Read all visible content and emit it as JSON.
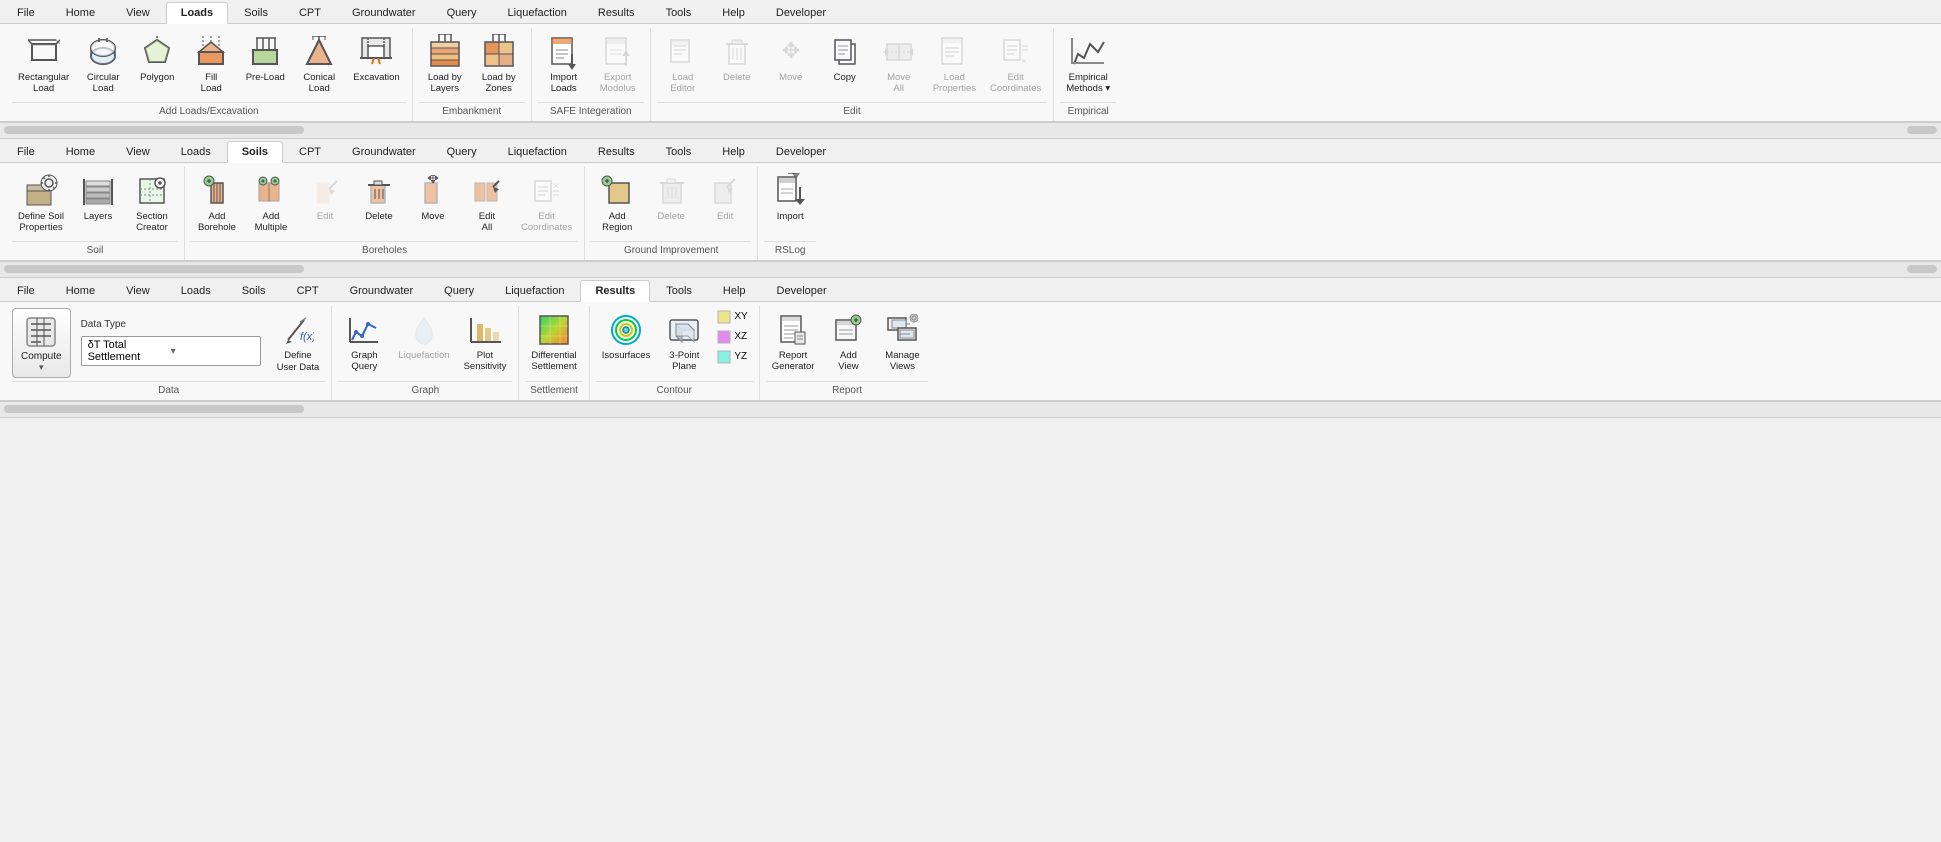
{
  "ribbons": [
    {
      "id": "loads-ribbon",
      "tabs": [
        "File",
        "Home",
        "View",
        "Loads",
        "Soils",
        "CPT",
        "Groundwater",
        "Query",
        "Liquefaction",
        "Results",
        "Tools",
        "Help",
        "Developer"
      ],
      "active_tab": "Loads",
      "groups": [
        {
          "id": "add-loads-excavation",
          "label": "Add Loads/Excavation",
          "buttons": [
            {
              "id": "rectangular-load",
              "label": "Rectangular\nLoad",
              "icon": "⬜",
              "disabled": false
            },
            {
              "id": "circular-load",
              "label": "Circular\nLoad",
              "icon": "⭕",
              "disabled": false
            },
            {
              "id": "polygon",
              "label": "Polygon",
              "icon": "⬠",
              "disabled": false
            },
            {
              "id": "fill-load",
              "label": "Fill\nLoad",
              "icon": "🟧",
              "disabled": false
            },
            {
              "id": "pre-load",
              "label": "Pre-Load",
              "icon": "🟩",
              "disabled": false
            },
            {
              "id": "conical-load",
              "label": "Conical\nLoad",
              "icon": "△",
              "disabled": false
            },
            {
              "id": "excavation",
              "label": "Excavation",
              "icon": "⛏",
              "disabled": false
            }
          ]
        },
        {
          "id": "embankment",
          "label": "Embankment",
          "buttons": [
            {
              "id": "load-by-layers",
              "label": "Load by\nLayers",
              "icon": "📊",
              "disabled": false
            },
            {
              "id": "load-by-zones",
              "label": "Load by\nZones",
              "icon": "📈",
              "disabled": false
            }
          ]
        },
        {
          "id": "safe-integration",
          "label": "SAFE Integeration",
          "buttons": [
            {
              "id": "import-loads",
              "label": "Import\nLoads",
              "icon": "📥",
              "disabled": false
            },
            {
              "id": "export-modolus",
              "label": "Export\nModolus",
              "icon": "📤",
              "disabled": true
            }
          ]
        },
        {
          "id": "edit-loads",
          "label": "Edit",
          "buttons": [
            {
              "id": "load-editor",
              "label": "Load\nEditor",
              "icon": "📝",
              "disabled": true
            },
            {
              "id": "delete-load",
              "label": "Delete",
              "icon": "🗑",
              "disabled": true
            },
            {
              "id": "move-load",
              "label": "Move",
              "icon": "✥",
              "disabled": true
            },
            {
              "id": "copy-load",
              "label": "Copy",
              "icon": "📋",
              "disabled": false
            },
            {
              "id": "move-all",
              "label": "Move\nAll",
              "icon": "⇄",
              "disabled": true
            },
            {
              "id": "load-properties",
              "label": "Load\nProperties",
              "icon": "📄",
              "disabled": true
            },
            {
              "id": "edit-coordinates",
              "label": "Edit\nCoordinates",
              "icon": "📌",
              "disabled": true
            }
          ]
        },
        {
          "id": "empirical",
          "label": "Empirical",
          "buttons": [
            {
              "id": "empirical-methods",
              "label": "Empirical\nMethods▾",
              "icon": "📉",
              "disabled": false
            }
          ]
        }
      ]
    },
    {
      "id": "soils-ribbon",
      "tabs": [
        "File",
        "Home",
        "View",
        "Loads",
        "Soils",
        "CPT",
        "Groundwater",
        "Query",
        "Liquefaction",
        "Results",
        "Tools",
        "Help",
        "Developer"
      ],
      "active_tab": "Soils",
      "groups": [
        {
          "id": "soil",
          "label": "Soil",
          "buttons": [
            {
              "id": "define-soil-properties",
              "label": "Define Soil\nProperties",
              "icon": "⚙",
              "disabled": false
            },
            {
              "id": "layers",
              "label": "Layers",
              "icon": "☰",
              "disabled": false
            },
            {
              "id": "section-creator",
              "label": "Section\nCreator",
              "icon": "✏",
              "disabled": false
            }
          ]
        },
        {
          "id": "boreholes",
          "label": "Boreholes",
          "buttons": [
            {
              "id": "add-borehole",
              "label": "Add\nBorehole",
              "icon": "➕",
              "disabled": false
            },
            {
              "id": "add-multiple",
              "label": "Add\nMultiple",
              "icon": "➕",
              "disabled": false
            },
            {
              "id": "edit-borehole",
              "label": "Edit",
              "icon": "✏",
              "disabled": true
            },
            {
              "id": "delete-borehole",
              "label": "Delete",
              "icon": "🗑",
              "disabled": false
            },
            {
              "id": "move-borehole",
              "label": "Move",
              "icon": "✥",
              "disabled": false
            },
            {
              "id": "edit-all",
              "label": "Edit\nAll",
              "icon": "✏",
              "disabled": false
            },
            {
              "id": "edit-coordinates-borehole",
              "label": "Edit\nCoordinates",
              "icon": "📌",
              "disabled": true
            }
          ]
        },
        {
          "id": "ground-improvement",
          "label": "Ground Improvement",
          "buttons": [
            {
              "id": "add-region",
              "label": "Add\nRegion",
              "icon": "➕",
              "disabled": false
            },
            {
              "id": "delete-region",
              "label": "Delete",
              "icon": "🗑",
              "disabled": true
            },
            {
              "id": "edit-region",
              "label": "Edit",
              "icon": "✏",
              "disabled": true
            }
          ]
        },
        {
          "id": "rslog",
          "label": "RSLog",
          "buttons": [
            {
              "id": "import-rslog",
              "label": "Import",
              "icon": "📥",
              "disabled": false
            }
          ]
        }
      ]
    },
    {
      "id": "results-ribbon",
      "tabs": [
        "File",
        "Home",
        "View",
        "Loads",
        "Soils",
        "CPT",
        "Groundwater",
        "Query",
        "Liquefaction",
        "Results",
        "Tools",
        "Help",
        "Developer"
      ],
      "active_tab": "Results",
      "data_type": {
        "label": "Data Type",
        "value": "δT  Total Settlement",
        "placeholder": "δT  Total Settlement"
      },
      "groups": [
        {
          "id": "data",
          "label": "Data",
          "has_compute": true,
          "compute_label": "Compute",
          "define_user_data_label": "Define\nUser Data",
          "define_icon": "fx"
        },
        {
          "id": "graph",
          "label": "Graph",
          "buttons": [
            {
              "id": "graph-query",
              "label": "Graph\nQuery",
              "icon": "📉",
              "disabled": false
            },
            {
              "id": "liquefaction-graph",
              "label": "Liquefaction",
              "icon": "💧",
              "disabled": true
            },
            {
              "id": "plot-sensitivity",
              "label": "Plot\nSensitivity",
              "icon": "📊",
              "disabled": false
            }
          ]
        },
        {
          "id": "settlement",
          "label": "Settlement",
          "buttons": [
            {
              "id": "differential-settlement",
              "label": "Differential\nSettlement",
              "icon": "🔀",
              "disabled": false
            }
          ]
        },
        {
          "id": "contour",
          "label": "Contour",
          "buttons": [
            {
              "id": "isosurfaces",
              "label": "Isosurfaces",
              "icon": "⊕",
              "disabled": false
            },
            {
              "id": "three-point-plane",
              "label": "3-Point\nPlane",
              "icon": "🔲",
              "disabled": false
            }
          ],
          "xyz_buttons": [
            {
              "id": "xy-view",
              "label": "XY",
              "icon": ""
            },
            {
              "id": "xz-view",
              "label": "XZ",
              "icon": ""
            },
            {
              "id": "yz-view",
              "label": "YZ",
              "icon": ""
            }
          ]
        },
        {
          "id": "report",
          "label": "Report",
          "buttons": [
            {
              "id": "report-generator",
              "label": "Report\nGenerator",
              "icon": "📄",
              "disabled": false
            },
            {
              "id": "add-view",
              "label": "Add\nView",
              "icon": "➕",
              "disabled": false
            },
            {
              "id": "manage-views",
              "label": "Manage\nViews",
              "icon": "🗂",
              "disabled": false
            }
          ]
        }
      ]
    }
  ]
}
